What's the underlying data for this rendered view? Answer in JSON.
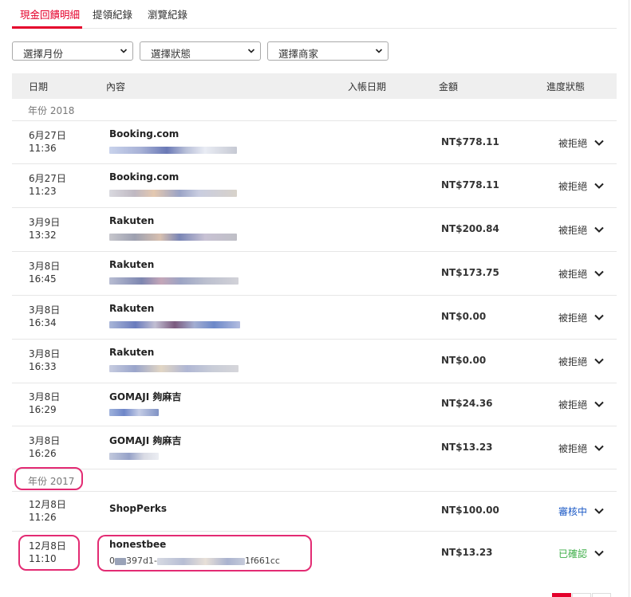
{
  "tabs": [
    {
      "label": "現金回饋明細",
      "active": true
    },
    {
      "label": "提領紀錄",
      "active": false
    },
    {
      "label": "瀏覽紀錄",
      "active": false
    }
  ],
  "filters": [
    {
      "label": "選擇月份"
    },
    {
      "label": "選擇狀態"
    },
    {
      "label": "選擇商家"
    }
  ],
  "table": {
    "headers": {
      "date": "日期",
      "content": "內容",
      "posted": "入帳日期",
      "amount": "金額",
      "status": "進度狀態"
    },
    "years": [
      "年份 2018",
      "年份 2017"
    ],
    "rows": [
      {
        "date": "6月27日",
        "time": "11:36",
        "merchant": "Booking.com",
        "ref": "11___756_______3____ .e_ _ _a",
        "amount": "NT$778.11",
        "status": "被拒絕",
        "status_color": "#333333"
      },
      {
        "date": "6月27日",
        "time": "11:23",
        "merchant": "Booking.com",
        "ref": "__________________ .___ __ d",
        "amount": "NT$778.11",
        "status": "被拒絕",
        "status_color": "#333333"
      },
      {
        "date": "3月9日",
        "time": "13:32",
        "merchant": "Rakuten",
        "ref": "0087063 100_____________3",
        "amount": "NT$200.84",
        "status": "被拒絕",
        "status_color": "#333333"
      },
      {
        "date": "3月8日",
        "time": "16:45",
        "merchant": "Rakuten",
        "ref": "0_____0_______________4._1__720_",
        "amount": "NT$173.75",
        "status": "被拒絕",
        "status_color": "#333333"
      },
      {
        "date": "3月8日",
        "time": "16:34",
        "merchant": "Rakuten",
        "ref": "________1000______________5010",
        "amount": "NT$0.00",
        "status": "被拒絕",
        "status_color": "#333333"
      },
      {
        "date": "3月8日",
        "time": "16:33",
        "merchant": "Rakuten",
        "ref": "_028874___________0025_90804",
        "amount": "NT$0.00",
        "status": "被拒絕",
        "status_color": "#333333"
      },
      {
        "date": "3月8日",
        "time": "16:29",
        "merchant": "GOMAJI 夠麻吉",
        "ref": "______a__",
        "amount": "NT$24.36",
        "status": "被拒絕",
        "status_color": "#333333"
      },
      {
        "date": "3月8日",
        "time": "16:26",
        "merchant": "GOMAJI 夠麻吉",
        "ref": "___0101___",
        "amount": "NT$13.23",
        "status": "被拒絕",
        "status_color": "#333333"
      },
      {
        "date": "12月8日",
        "time": "11:26",
        "merchant": "ShopPerks",
        "ref": "",
        "amount": "NT$100.00",
        "status": "審核中",
        "status_color": "#1b59c6"
      },
      {
        "date": "12月8日",
        "time": "11:10",
        "merchant": "honestbee",
        "ref": "0___397d1-_________________4_1f661cc",
        "amount": "NT$13.23",
        "status": "已確認",
        "status_color": "#3fae49"
      }
    ]
  },
  "colors": {
    "accent": "#e4002b",
    "highlight": "#e32b73",
    "header_bg": "#efefef"
  },
  "icons": {
    "dropdown": "chevron-down-icon",
    "expand": "chevron-down-icon"
  }
}
